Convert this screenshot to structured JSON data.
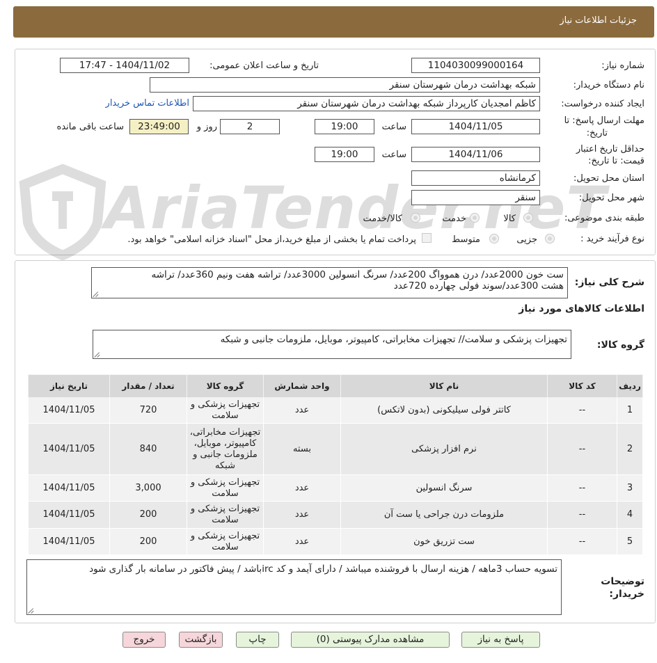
{
  "header": {
    "title": "جزئیات اطلاعات نیاز"
  },
  "form": {
    "need_number_label": "شماره نیاز:",
    "need_number": "1104030099000164",
    "announce_label": "تاریخ و ساعت اعلان عمومی:",
    "announce_value": "1404/11/02 - 17:47",
    "buyer_org_label": "نام دستگاه خریدار:",
    "buyer_org": "شبکه بهداشت درمان شهرستان سنقر",
    "requester_label": "ایجاد کننده درخواست:",
    "requester": "کاظم امجدیان کارپرداز شبکه بهداشت درمان شهرستان سنقر",
    "contact_link": "اطلاعات تماس خریدار",
    "deadline_label_1": "مهلت ارسال پاسخ: تا",
    "deadline_label_2": "تاریخ:",
    "deadline_date": "1404/11/05",
    "time_label": "ساعت",
    "deadline_time": "19:00",
    "days_value": "2",
    "days_label": "روز و",
    "remaining_time": "23:49:00",
    "remaining_label": "ساعت باقی مانده",
    "validity_label_1": "حداقل تاریخ اعتبار",
    "validity_label_2": "قیمت: تا تاریخ:",
    "validity_date": "1404/11/06",
    "validity_time": "19:00",
    "province_label": "استان محل تحویل:",
    "province": "کرمانشاه",
    "city_label": "شهر محل تحویل:",
    "city": "سنقر",
    "category_label": "طبقه بندی موضوعی:",
    "category_options": [
      "کالا",
      "خدمت",
      "کالا/خدمت"
    ],
    "process_label": "نوع فرآیند خرید :",
    "process_options": [
      "جزیی",
      "متوسط"
    ],
    "payment_note": "پرداخت تمام یا بخشی از مبلغ خرید،از محل \"اسناد خزانه اسلامی\" خواهد بود."
  },
  "details": {
    "summary_label": "شرح کلی نیاز:",
    "summary_line1": "ست خون 2000عدد/ درن هموواگ 200عدد/ سرنگ انسولین 3000عدد/ تراشه هفت ونیم 360عدد/ تراشه",
    "summary_line2": "هشت 300عدد/سوند فولی چهارده 720عدد",
    "goods_info_title": "اطلاعات کالاهای مورد نیاز",
    "goods_group_label": "گروه کالا:",
    "goods_group": "تجهیزات پزشکی و سلامت// تجهیزات مخابراتی، کامپیوتر، موبایل، ملزومات جانبی و شبکه"
  },
  "table": {
    "headers": [
      "ردیف",
      "کد کالا",
      "نام کالا",
      "واحد شمارش",
      "گروه کالا",
      "تعداد / مقدار",
      "تاریخ نیاز"
    ],
    "rows": [
      {
        "row": "1",
        "code": "--",
        "name": "کاتتر فولی سیلیکونی (بدون لاتکس)",
        "unit": "عدد",
        "group": "تجهیزات پزشکی و سلامت",
        "qty": "720",
        "date": "1404/11/05"
      },
      {
        "row": "2",
        "code": "--",
        "name": "نرم افزار پزشکی",
        "unit": "بسته",
        "group": "تجهیزات مخابراتی، کامپیوتر، موبایل، ملزومات جانبی و شبکه",
        "qty": "840",
        "date": "1404/11/05"
      },
      {
        "row": "3",
        "code": "--",
        "name": "سرنگ انسولین",
        "unit": "عدد",
        "group": "تجهیزات پزشکی و سلامت",
        "qty": "3,000",
        "date": "1404/11/05"
      },
      {
        "row": "4",
        "code": "--",
        "name": "ملزومات درن جراحی یا ست آن",
        "unit": "عدد",
        "group": "تجهیزات پزشکی و سلامت",
        "qty": "200",
        "date": "1404/11/05"
      },
      {
        "row": "5",
        "code": "--",
        "name": "ست تزریق خون",
        "unit": "عدد",
        "group": "تجهیزات پزشکی و سلامت",
        "qty": "200",
        "date": "1404/11/05"
      }
    ]
  },
  "notes": {
    "label_1": "توضیحات",
    "label_2": "خریدار:",
    "text": "تسویه حساب 3ماهه / هزینه ارسال با فروشنده میباشد / دارای آیمد و کد ircباشد / پیش فاکتور در سامانه بار گذاری شود"
  },
  "buttons": {
    "reply": "پاسخ به نیاز",
    "attachments": "مشاهده مدارک پیوستی (0)",
    "print": "چاپ",
    "back": "بازگشت",
    "exit": "خروج"
  },
  "watermark": {
    "text": "AriaTender.neT"
  }
}
